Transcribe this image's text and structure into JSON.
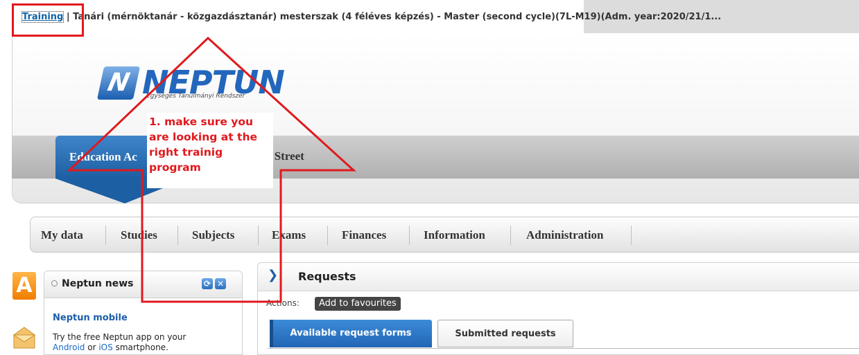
{
  "training_bar": {
    "link_label": "Training",
    "separator": "|",
    "program": "Tanári (mérnöktanár - közgazdásztanár) mesterszak (4 féléves képzés) - Master (second cycle)(7L-M19)(Adm. year:2020/21/1..."
  },
  "header": {
    "logo_text": "NEPTUN",
    "logo_letter": "N",
    "logo_subtitle": "Egységes Tanulmányi Rendszer",
    "education_tab": "Education Ac",
    "street_text": "leet Street"
  },
  "main_menu": {
    "items": [
      "My data",
      "Studies",
      "Subjects",
      "Exams",
      "Finances",
      "Information",
      "Administration"
    ]
  },
  "side_icons": {
    "a_letter": "A"
  },
  "news": {
    "title": "Neptun news",
    "item_title": "Neptun mobile",
    "text_before": "Try the free Neptun app on your",
    "link_android": "Android",
    "text_or": "or",
    "link_ios": "iOS",
    "text_after": "smartphone."
  },
  "requests": {
    "title": "Requests",
    "actions_label": "Actions:",
    "favourites_button": "Add to favourites",
    "tabs": [
      "Available request forms",
      "Submitted requests"
    ]
  },
  "annotation": {
    "note_lines": [
      "1. make sure you",
      "are looking at the",
      "right trainig",
      "program"
    ],
    "color": "#e0191d"
  },
  "colors": {
    "accent": "#1d5fa3",
    "link": "#0f63a8",
    "annotation": "#e0191d"
  }
}
